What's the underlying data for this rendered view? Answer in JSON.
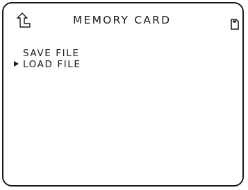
{
  "screen": {
    "title": "MEMORY CARD",
    "back_icon": "back-arrow-icon",
    "card_icon": "memory-card-icon"
  },
  "menu": {
    "items": [
      {
        "label": "SAVE FILE",
        "selected": false
      },
      {
        "label": "LOAD FILE",
        "selected": true
      }
    ],
    "cursor_icon": "triangle-pointer-icon"
  },
  "colors": {
    "foreground": "#1a1a1a",
    "background": "#ffffff"
  }
}
